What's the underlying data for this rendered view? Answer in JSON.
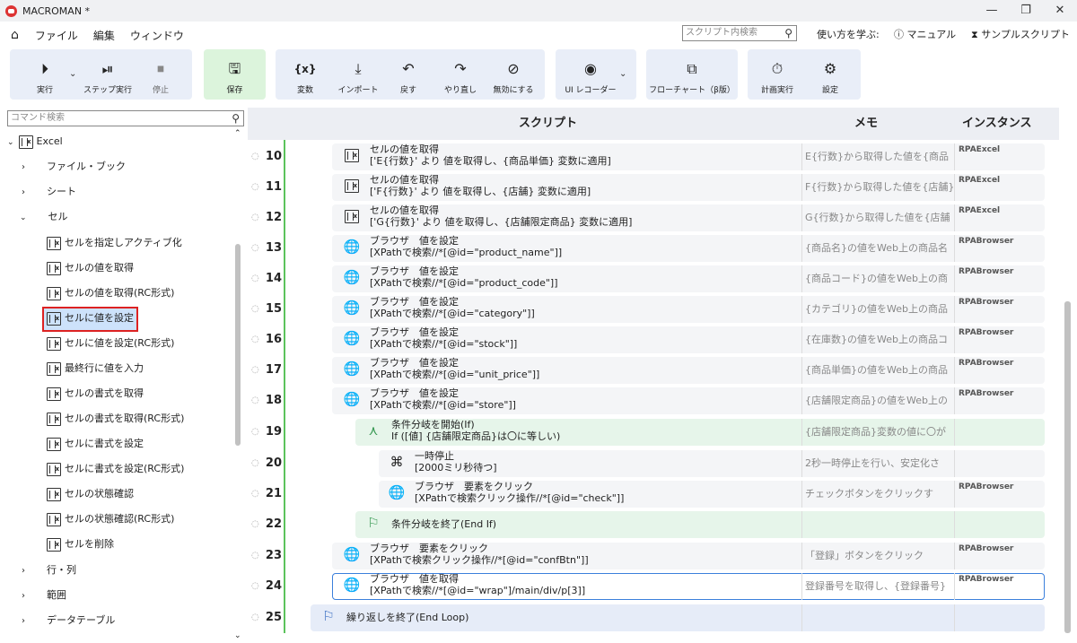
{
  "app": {
    "title": "MACROMAN *"
  },
  "window": {
    "minimize": "—",
    "maximize": "❐",
    "close": "✕"
  },
  "menu": [
    "ファイル",
    "編集",
    "ウィンドウ"
  ],
  "search": {
    "placeholder": "スクリプト内検索"
  },
  "help_links": {
    "learn": "使い方を学ぶ:",
    "manual": "マニュアル",
    "sample": "サンプルスクリプト"
  },
  "ribbon": {
    "run": "実行",
    "step": "ステップ実行",
    "stop": "停止",
    "save": "保存",
    "variable": "変数",
    "import": "インポート",
    "undo": "戻す",
    "redo": "やり直し",
    "disable": "無効にする",
    "ui_recorder": "UI レコーダー",
    "flowchart": "フローチャート（β版）",
    "schedule": "計画実行",
    "settings": "設定"
  },
  "left": {
    "search_placeholder": "コマンド検索",
    "root": "Excel",
    "groups": {
      "file_book": "ファイル・ブック",
      "sheet": "シート",
      "cell": "セル",
      "row_col": "行・列",
      "range": "範囲",
      "datatable": "データテーブル"
    },
    "items": [
      "セルを指定しアクティブ化",
      "セルの値を取得",
      "セルの値を取得(RC形式)",
      "セルに値を設定",
      "セルに値を設定(RC形式)",
      "最終行に値を入力",
      "セルの書式を取得",
      "セルの書式を取得(RC形式)",
      "セルに書式を設定",
      "セルに書式を設定(RC形式)",
      "セルの状態確認",
      "セルの状態確認(RC形式)",
      "セルを削除"
    ]
  },
  "table": {
    "col_script": "スクリプト",
    "col_memo": "メモ",
    "col_instance": "インスタンス"
  },
  "rows": [
    {
      "num": "10",
      "line1": "セルの値を取得",
      "line2": "['E{行数}' より 値を取得し、{商品単価} 変数に適用]",
      "memo": "E{行数}から取得した値を{商品",
      "inst": "RPAExcel"
    },
    {
      "num": "11",
      "line1": "セルの値を取得",
      "line2": "['F{行数}' より 値を取得し、{店舗} 変数に適用]",
      "memo": "F{行数}から取得した値を{店舗}",
      "inst": "RPAExcel"
    },
    {
      "num": "12",
      "line1": "セルの値を取得",
      "line2": "['G{行数}' より 値を取得し、{店舗限定商品} 変数に適用]",
      "memo": "G{行数}から取得した値を{店舗",
      "inst": "RPAExcel"
    },
    {
      "num": "13",
      "line1": "ブラウザ　値を設定",
      "line2": "[XPathで検索//*[@id=\"product_name\"]]",
      "memo": "{商品名}の値をWeb上の商品名",
      "inst": "RPABrowser"
    },
    {
      "num": "14",
      "line1": "ブラウザ　値を設定",
      "line2": "[XPathで検索//*[@id=\"product_code\"]]",
      "memo": "{商品コード}の値をWeb上の商",
      "inst": "RPABrowser"
    },
    {
      "num": "15",
      "line1": "ブラウザ　値を設定",
      "line2": "[XPathで検索//*[@id=\"category\"]]",
      "memo": "{カテゴリ}の値をWeb上の商品",
      "inst": "RPABrowser"
    },
    {
      "num": "16",
      "line1": "ブラウザ　値を設定",
      "line2": "[XPathで検索//*[@id=\"stock\"]]",
      "memo": "{在庫数}の値をWeb上の商品コ",
      "inst": "RPABrowser"
    },
    {
      "num": "17",
      "line1": "ブラウザ　値を設定",
      "line2": "[XPathで検索//*[@id=\"unit_price\"]]",
      "memo": "{商品単価}の値をWeb上の商品",
      "inst": "RPABrowser"
    },
    {
      "num": "18",
      "line1": "ブラウザ　値を設定",
      "line2": "[XPathで検索//*[@id=\"store\"]]",
      "memo": "{店舗限定商品}の値をWeb上の",
      "inst": "RPABrowser"
    },
    {
      "num": "19",
      "line1": "条件分岐を開始(If)",
      "line2": "If ([値] {店舗限定商品}は〇に等しい)",
      "memo": "{店舗限定商品}変数の値に〇が",
      "inst": ""
    },
    {
      "num": "20",
      "line1": "一時停止",
      "line2": "[2000ミリ秒待つ]",
      "memo": "2秒一時停止を行い、安定化さ",
      "inst": ""
    },
    {
      "num": "21",
      "line1": "ブラウザ　要素をクリック",
      "line2": "[XPathで検索クリック操作//*[@id=\"check\"]]",
      "memo": "チェックボタンをクリックす",
      "inst": "RPABrowser"
    },
    {
      "num": "22",
      "line1": "条件分岐を終了(End If)",
      "line2": "",
      "memo": "",
      "inst": ""
    },
    {
      "num": "23",
      "line1": "ブラウザ　要素をクリック",
      "line2": "[XPathで検索クリック操作//*[@id=\"confBtn\"]]",
      "memo": "「登録」ボタンをクリック",
      "inst": "RPABrowser"
    },
    {
      "num": "24",
      "line1": "ブラウザ　値を取得",
      "line2": "[XPathで検索//*[@id=\"wrap\"]/main/div/p[3]]",
      "memo": "登録番号を取得し、{登録番号}",
      "inst": "RPABrowser"
    },
    {
      "num": "25",
      "line1": "繰り返しを終了(End Loop)",
      "line2": "",
      "memo": "",
      "inst": ""
    }
  ]
}
